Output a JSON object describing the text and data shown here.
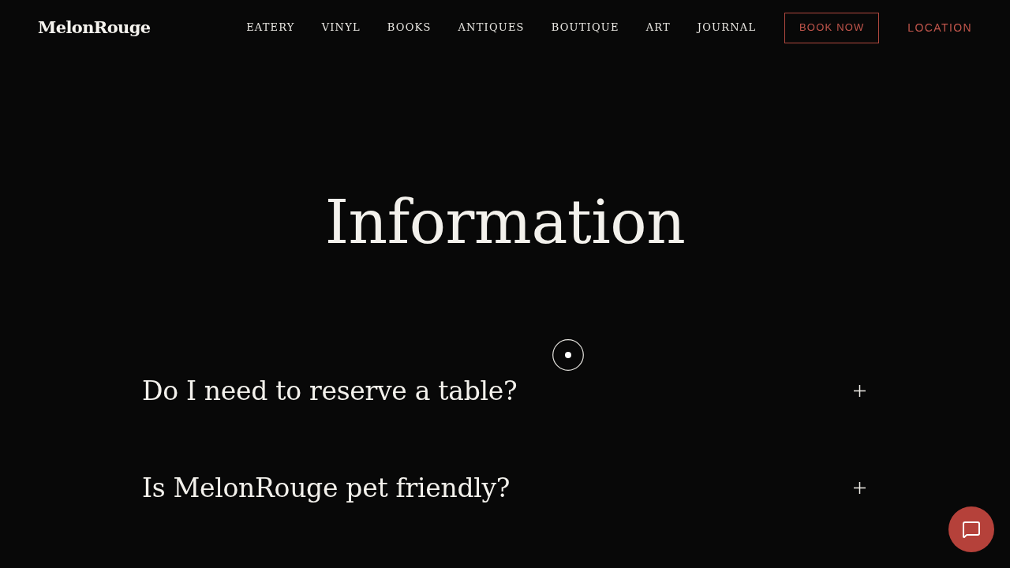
{
  "header": {
    "logo": "MelonRouge",
    "nav": [
      "EATERY",
      "VINYL",
      "BOOKS",
      "ANTIQUES",
      "BOUTIQUE",
      "ART",
      "JOURNAL"
    ],
    "book_button": "BOOK NOW",
    "location_link": "LOCATION"
  },
  "page_title": "Information",
  "faq": [
    {
      "question": "Do I need to reserve a table?",
      "expanded": false
    },
    {
      "question": "Is MelonRouge pet friendly?",
      "expanded": false
    }
  ]
}
